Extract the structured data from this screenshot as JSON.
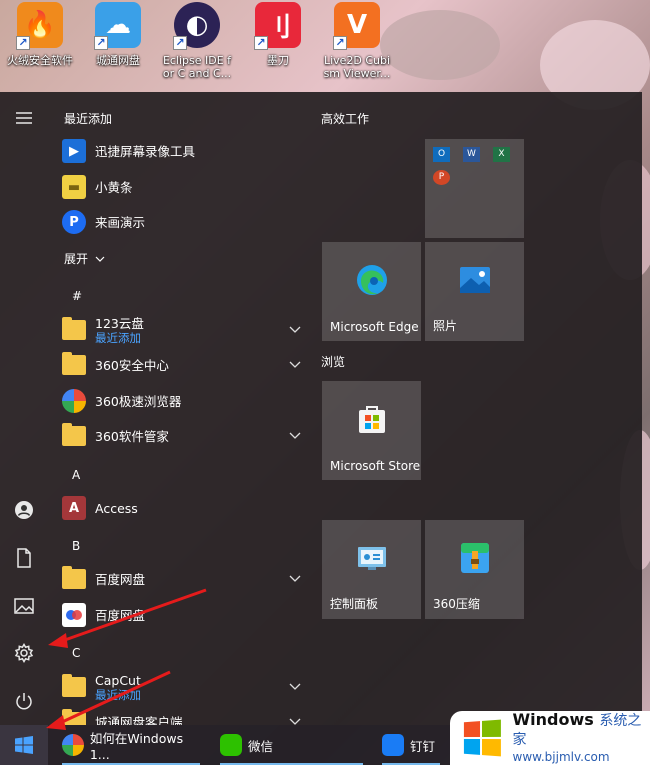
{
  "desktop": {
    "icons": [
      {
        "label": "火绒安全软件",
        "color": "#f08a1c",
        "glyph": "🔥"
      },
      {
        "label": "城通网盘",
        "color": "#3aa0e8",
        "glyph": "☁"
      },
      {
        "label": "Eclipse IDE f\nor C and C...",
        "color": "#2c2255",
        "glyph": "◐"
      },
      {
        "label": "墨刀",
        "color": "#e8283a",
        "glyph": "刂"
      },
      {
        "label": "Live2D Cubi\nsm Viewer...",
        "color": "#f37021",
        "glyph": "V"
      }
    ]
  },
  "rail": {
    "menu_icon": "hamburger-icon",
    "items": [
      "account-icon",
      "document-icon",
      "pictures-icon",
      "settings-icon",
      "power-icon"
    ]
  },
  "applist": {
    "recent_header": "最近添加",
    "recent": [
      {
        "name": "迅捷屏幕录像工具",
        "color": "#1c6fd8",
        "glyph": "▶"
      },
      {
        "name": "小黄条",
        "color": "#f0d043",
        "glyph": "▬"
      },
      {
        "name": "来画演示",
        "color": "#1d6cf2",
        "glyph": "P"
      }
    ],
    "expand_label": "展开",
    "groups": [
      {
        "letter": "#"
      },
      {
        "letter": "A"
      },
      {
        "letter": "B"
      },
      {
        "letter": "C"
      }
    ],
    "apps": [
      {
        "name": "123云盘",
        "sub": "最近添加",
        "folder": true,
        "chevron": true
      },
      {
        "name": "360安全中心",
        "sub": "",
        "folder": true,
        "chevron": true
      },
      {
        "name": "360极速浏览器",
        "sub": "",
        "folder": false,
        "chevron": false
      },
      {
        "name": "360软件管家",
        "sub": "",
        "folder": true,
        "chevron": true
      },
      {
        "name": "Access",
        "sub": "",
        "folder": false,
        "chevron": false
      },
      {
        "name": "百度网盘",
        "sub": "",
        "folder": true,
        "chevron": true
      },
      {
        "name": "百度网盘",
        "sub": "",
        "folder": false,
        "chevron": false
      },
      {
        "name": "CapCut",
        "sub": "最近添加",
        "folder": true,
        "chevron": true
      },
      {
        "name": "城通网盘客户端",
        "sub": "",
        "folder": true,
        "chevron": true
      }
    ]
  },
  "tiles": {
    "group1": "高效工作",
    "group2": "浏览",
    "items": {
      "office": "",
      "edge": "Microsoft Edge",
      "photos": "照片",
      "store": "Microsoft Store",
      "control": "控制面板",
      "zip": "360压缩"
    }
  },
  "taskbar": {
    "tasks": [
      {
        "label": "如何在Windows 1...",
        "icon": "browser-360-icon"
      },
      {
        "label": "微信",
        "icon": "wechat-icon"
      },
      {
        "label": "钉钉",
        "icon": "dingtalk-icon"
      }
    ]
  },
  "watermark": {
    "title": "Windows",
    "title_cn": "系统之家",
    "url": "www.bjjmlv.com"
  }
}
